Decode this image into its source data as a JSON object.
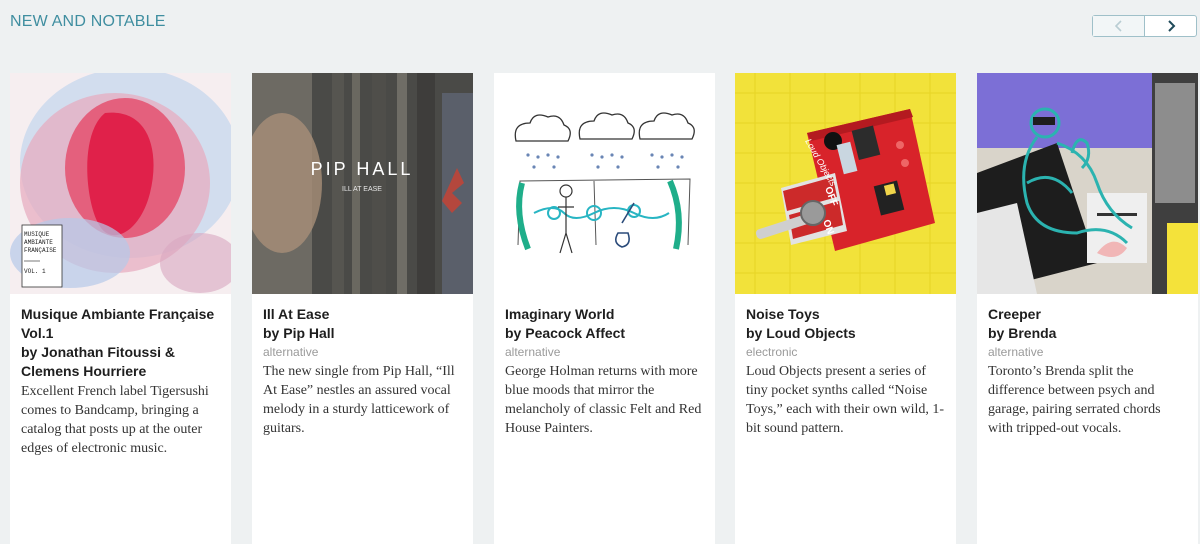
{
  "section": {
    "title": "NEW AND NOTABLE"
  },
  "pager": {
    "prev_icon": "chevron-left-icon",
    "next_icon": "chevron-right-icon"
  },
  "cards": [
    {
      "title": "Musique Ambiante Française Vol.1",
      "artist": "by Jonathan Fitoussi & Clemens Hourriere",
      "genre": "",
      "description": "Excellent French label Tigersushi comes to Bandcamp, bringing a catalog that posts up at the outer edges of electronic music.",
      "art_text": [
        "MUSIQUE",
        "AMBIANTE",
        "FRANÇAISE",
        "VOL. 1"
      ]
    },
    {
      "title": "Ill At Ease",
      "artist": "by Pip Hall",
      "genre": "alternative",
      "description": "The new single from Pip Hall, “Ill At Ease” nestles an assured vocal melody in a sturdy latticework of guitars.",
      "art_text": [
        "PIP HALL",
        "ILL AT EASE"
      ]
    },
    {
      "title": "Imaginary World",
      "artist": "by Peacock Affect",
      "genre": "alternative",
      "description": "George Holman returns with more blue moods that mirror the melancholy of classic Felt and Red House Painters."
    },
    {
      "title": "Noise Toys",
      "artist": "by Loud Objects",
      "genre": "electronic",
      "description": "Loud Objects present a series of tiny pocket synths called “Noise Toys,” each with their own wild, 1-bit sound pattern.",
      "art_text": [
        "Loud Objects",
        "ON",
        "OFF"
      ]
    },
    {
      "title": "Creeper",
      "artist": "by Brenda",
      "genre": "alternative",
      "description": "Toronto’s Brenda split the difference between psych and garage, pairing serrated chords with tripped-out vocals."
    }
  ]
}
